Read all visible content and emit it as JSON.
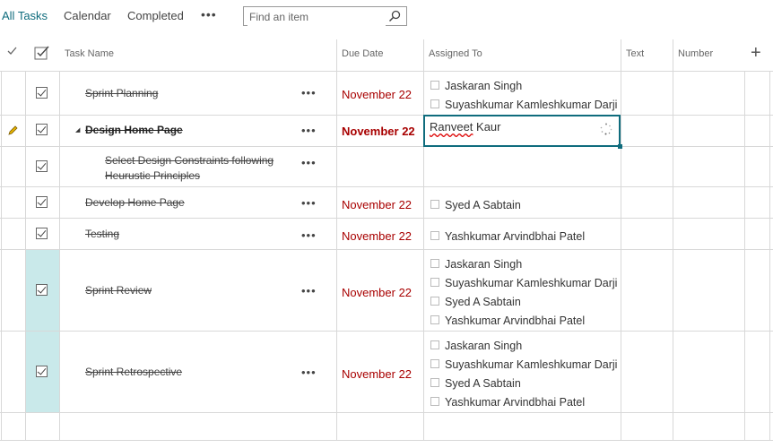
{
  "views": [
    "All Tasks",
    "Calendar",
    "Completed"
  ],
  "more_views_label": "•••",
  "search": {
    "placeholder": "Find an item"
  },
  "columns": {
    "task_name": "Task Name",
    "due_date": "Due Date",
    "assigned_to": "Assigned To",
    "text": "Text",
    "number": "Number",
    "add": "+"
  },
  "rows": [
    {
      "task": "Sprint Planning",
      "due": "November 22",
      "assigned": [
        "Jaskaran Singh",
        "Suyashkumar Kamleshkumar Darji"
      ]
    },
    {
      "task": "Design Home Page",
      "due": "November 22",
      "editing_value": [
        "Ranveet",
        " Kaur"
      ],
      "expand_glyph": "◢"
    },
    {
      "task": "Select Design Constraints following Heurustic Principles"
    },
    {
      "task": "Develop Home Page",
      "due": "November 22",
      "assigned": [
        "Syed A Sabtain"
      ]
    },
    {
      "task": "Testing",
      "due": "November 22",
      "assigned": [
        "Yashkumar Arvindbhai Patel"
      ]
    },
    {
      "task": "Sprint Review",
      "due": "November 22",
      "assigned": [
        "Jaskaran Singh",
        "Suyashkumar Kamleshkumar Darji",
        "Syed A Sabtain",
        "Yashkumar Arvindbhai Patel"
      ]
    },
    {
      "task": "Sprint Retrospective",
      "due": "November 22",
      "assigned": [
        "Jaskaran Singh",
        "Suyashkumar Kamleshkumar Darji",
        "Syed A Sabtain",
        "Yashkumar Arvindbhai Patel"
      ]
    }
  ],
  "row_menu_label": "•••",
  "colors": {
    "accent": "#0f6c7d",
    "due": "#a80000",
    "selected": "#c9e9ea"
  }
}
